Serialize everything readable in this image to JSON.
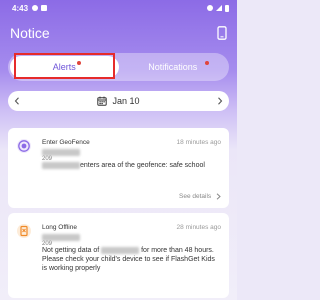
{
  "status_bar": {
    "time": "4:43"
  },
  "header": {
    "title": "Notice"
  },
  "tabs": [
    {
      "label": "Alerts",
      "has_dot": true,
      "selected": true
    },
    {
      "label": "Notifications",
      "has_dot": true,
      "selected": false
    }
  ],
  "date": {
    "label": "Jan 10"
  },
  "cards": [
    {
      "title": "Enter GeoFence",
      "time": "18 minutes ago",
      "device_suffix": "209",
      "body_after_blur": "enters area of the geofence: safe school",
      "link": "See details",
      "icon": "geofence-target-icon"
    },
    {
      "title": "Long Offline",
      "time": "28 minutes ago",
      "device_suffix": "209",
      "body_before_blur": "Not getting data of ",
      "body_after_blur": "for more than 48 hours. Please check your child's device to see if FlashGet Kids is working properly",
      "icon": "offline-phone-icon"
    }
  ],
  "colors": {
    "accent": "#8c6be6",
    "alert_dot": "#e0453d",
    "highlight": "#e62b2b"
  }
}
